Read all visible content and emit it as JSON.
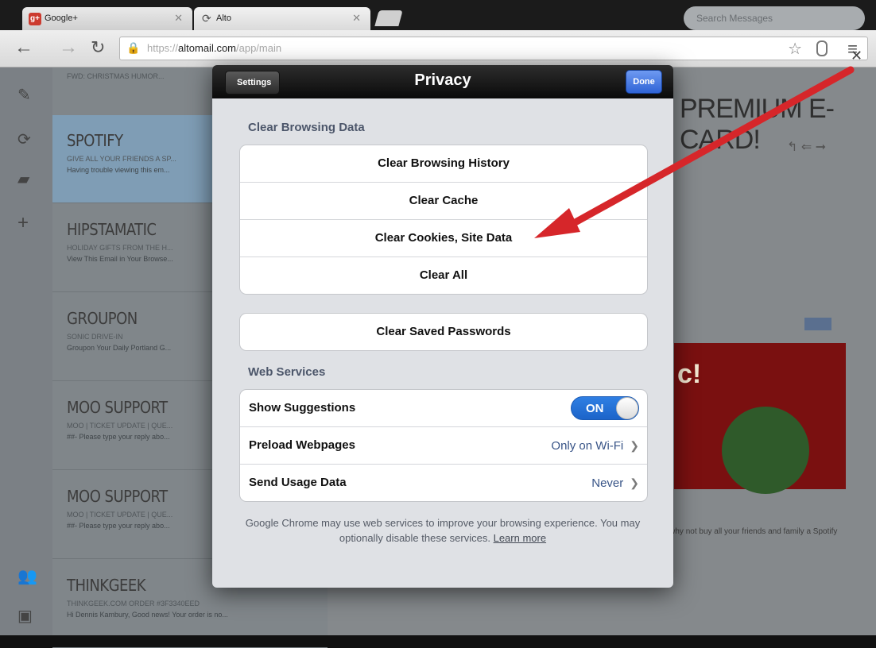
{
  "browser": {
    "tabs": [
      {
        "title": "Google+",
        "favicon": "google-plus-icon"
      },
      {
        "title": "Alto",
        "favicon": "alto-icon"
      }
    ],
    "url_prefix": "https://",
    "url_host": "altomail.com",
    "url_path": "/app/main"
  },
  "background": {
    "search_placeholder": "Search Messages",
    "top_subject": "FWD: CHRISTMAS HUMOR...",
    "messages": [
      {
        "sender": "SPOTIFY",
        "subject": "GIVE ALL YOUR FRIENDS A SP...",
        "preview": "Having trouble viewing this em..."
      },
      {
        "sender": "HIPSTAMATIC",
        "subject": "HOLIDAY GIFTS FROM THE H...",
        "preview": "View This Email in Your Browse..."
      },
      {
        "sender": "GROUPON",
        "subject": "SONIC DRIVE-IN",
        "preview": "Groupon Your Daily Portland G..."
      },
      {
        "sender": "MOO SUPPORT",
        "subject": "MOO | TICKET UPDATE | QUE...",
        "preview": "##- Please type your reply abo..."
      },
      {
        "sender": "MOO SUPPORT",
        "subject": "MOO | TICKET UPDATE | QUE...",
        "preview": "##- Please type your reply abo..."
      },
      {
        "sender": "THINKGEEK",
        "subject": "THINKGEEK.COM ORDER #3F3340EED",
        "preview": "Hi Dennis Kambury, Good news! Your order is no..."
      }
    ],
    "reader_heading": "PREMIUM E-CARD!",
    "promo_text": "c!",
    "reader_body": "All the music you could ever want? That's got to be the best festive gift ever! So why not buy all your friends and family a Spotify Premium e-card? They come in four amounts – which your"
  },
  "dialog": {
    "title": "Privacy",
    "back_label": "Settings",
    "done_label": "Done",
    "clear_section_label": "Clear Browsing Data",
    "clear_rows": [
      "Clear Browsing History",
      "Clear Cache",
      "Clear Cookies, Site Data",
      "Clear All"
    ],
    "clear_passwords_label": "Clear Saved Passwords",
    "web_services_label": "Web Services",
    "show_suggestions_label": "Show Suggestions",
    "show_suggestions_state": "ON",
    "preload_label": "Preload Webpages",
    "preload_value": "Only on Wi-Fi",
    "usage_label": "Send Usage Data",
    "usage_value": "Never",
    "footer_text": "Google Chrome may use web services to improve your browsing experience. You may optionally disable these services.",
    "learn_more": "Learn more"
  },
  "colors": {
    "arrow": "#d6262a",
    "toggle_on": "#2f7fe3",
    "done_button": "#3f73e0"
  }
}
